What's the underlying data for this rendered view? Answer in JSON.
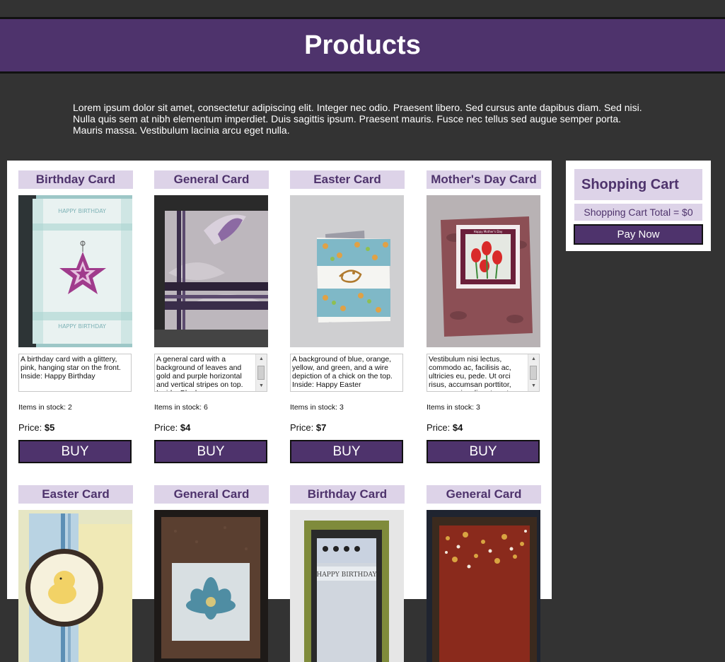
{
  "header": {
    "title": "Products"
  },
  "intro": "Lorem ipsum dolor sit amet, consectetur adipiscing elit. Integer nec odio. Praesent libero. Sed cursus ante dapibus diam. Sed nisi. Nulla quis sem at nibh elementum imperdiet. Duis sagittis ipsum. Praesent mauris. Fusce nec tellus sed augue semper porta. Mauris massa. Vestibulum lacinia arcu eget nulla.",
  "products": [
    {
      "title": "Birthday Card",
      "description": "A birthday card with a glittery, pink, hanging star on the front. Inside: Happy Birthday",
      "stock_label": "Items in stock: 2",
      "price_label": "Price:",
      "price": "$5",
      "buy_label": "BUY"
    },
    {
      "title": "General Card",
      "description": "A general card with a background of leaves and gold and purple horizontal and vertical stripes on top. Inside: Blank",
      "stock_label": "Items in stock: 6",
      "price_label": "Price:",
      "price": "$4",
      "buy_label": "BUY"
    },
    {
      "title": "Easter Card",
      "description": "A background of blue, orange, yellow, and green, and a wire depiction of a chick on the top. Inside: Happy Easter",
      "stock_label": "Items in stock: 3",
      "price_label": "Price:",
      "price": "$7",
      "buy_label": "BUY"
    },
    {
      "title": "Mother's Day Card",
      "description": "Vestibulum nisi lectus, commodo ac, facilisis ac, ultricies eu, pede. Ut orci risus, accumsan porttitor, cursus quis, aliquet eget, justo.",
      "stock_label": "Items in stock: 3",
      "price_label": "Price:",
      "price": "$4",
      "buy_label": "BUY"
    },
    {
      "title": "Easter Card"
    },
    {
      "title": "General Card"
    },
    {
      "title": "Birthday Card"
    },
    {
      "title": "General Card"
    }
  ],
  "card_art_text": {
    "birthday_top": "HAPPY BIRTHDAY",
    "birthday_bottom": "HAPPY BIRTHDAY",
    "mothers_day": "Happy Mother's Day",
    "birthday2": "HAPPY BIRTHDAY"
  },
  "cart": {
    "title": "Shopping Cart",
    "total": "Shopping Cart Total = $0",
    "pay_label": "Pay Now"
  },
  "colors": {
    "page_bg": "#333333",
    "brand_purple": "#4e336c",
    "label_bg": "#ddd3e8"
  }
}
